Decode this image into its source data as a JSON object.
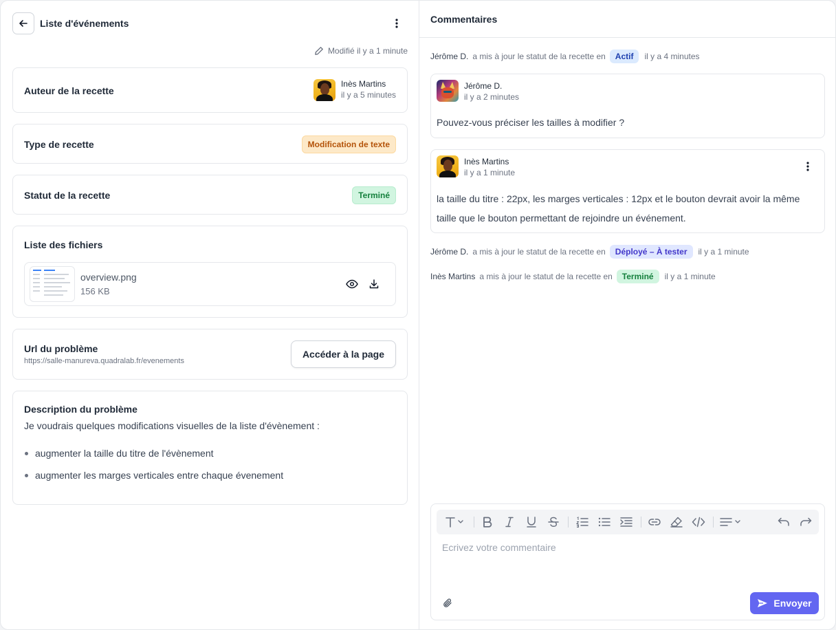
{
  "header": {
    "title": "Liste d'événements",
    "modified": "Modifié il y a 1 minute"
  },
  "author": {
    "label": "Auteur de la recette",
    "name": "Inès Martins",
    "time": "il y a 5 minutes"
  },
  "recipe_type": {
    "label": "Type de recette",
    "value": "Modification de texte",
    "color": "#fde9c8"
  },
  "recipe_status": {
    "label": "Statut de la recette",
    "value": "Terminé",
    "color": "#d1f5e0"
  },
  "files": {
    "label": "Liste des fichiers",
    "items": [
      {
        "name": "overview.png",
        "size": "156 KB"
      }
    ]
  },
  "problem_url": {
    "label": "Url du problème",
    "url": "https://salle-manureva.quadralab.fr/evenements",
    "button": "Accéder à la page"
  },
  "description": {
    "label": "Description du problème",
    "intro": "Je voudrais quelques modifications visuelles de la liste d'évènement :",
    "items": [
      "augmenter la taille du titre de l'évènement",
      "augmenter les marges verticales entre chaque évenement"
    ]
  },
  "comments": {
    "title": "Commentaires",
    "activities": [
      {
        "who": "Jérôme D.",
        "text": "a mis à jour le statut de la recette en",
        "status": "Actif",
        "time": "il y a 4 minutes"
      },
      {
        "who": "Jérôme D.",
        "text": "a mis à jour le statut de la recette en",
        "status": "Déployé – À tester",
        "time": "il y a 1 minute"
      },
      {
        "who": "Inès Martins",
        "text": "a mis à jour le statut de la recette en",
        "status": "Terminé",
        "time": "il y a 1 minute"
      }
    ],
    "messages": [
      {
        "author": "Jérôme D.",
        "time": "il y a 2 minutes",
        "text": "Pouvez-vous préciser les tailles à modifier ?"
      },
      {
        "author": "Inès Martins",
        "time": "il y a 1 minute",
        "line1": "la taille du titre : 22px, les marges verticales : 12px et le bouton devrait avoir la même",
        "line2": "taille que le bouton permettant de rejoindre un événement."
      }
    ]
  },
  "editor": {
    "placeholder": "Ecrivez votre commentaire",
    "send": "Envoyer",
    "accent": "#6366f1",
    "toolbar_icons": [
      "text-style-icon",
      "bold-icon",
      "italic-icon",
      "underline-icon",
      "strikethrough-icon",
      "ordered-list-icon",
      "bullet-list-icon",
      "indent-icon",
      "link-icon",
      "highlight-icon",
      "code-icon",
      "align-icon",
      "undo-icon",
      "redo-icon"
    ]
  },
  "status_colors": {
    "actif": "#dbeafe",
    "deploye": "#e0e7ff",
    "termine": "#d1f5e0"
  }
}
